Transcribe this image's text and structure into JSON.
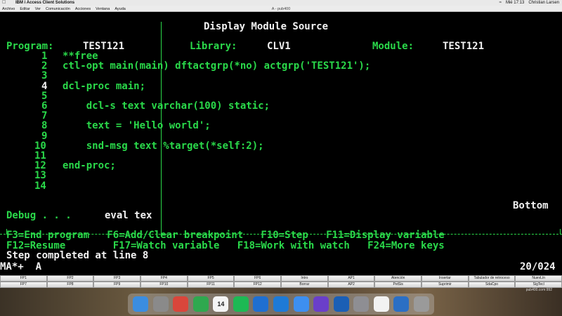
{
  "menubar": {
    "app_name": "IBM i Access Client Solutions",
    "clock": "Mié 17:13",
    "user": "Christian Larsen"
  },
  "appmenu": {
    "items": [
      "Archivo",
      "Editar",
      "Ver",
      "Comunicación",
      "Acciones",
      "Ventana",
      "Ayuda"
    ],
    "window_title": "A - pub400"
  },
  "screen": {
    "header": "Display Module Source",
    "program_label": "Program:",
    "program_value": "TEST121",
    "library_label": "Library:",
    "library_value": "CLV1",
    "module_label": "Module:",
    "module_value": "TEST121",
    "source_lines": [
      {
        "num": "1",
        "text": "**free"
      },
      {
        "num": "2",
        "text": "ctl-opt main(main) dftactgrp(*no) actgrp('TEST121');"
      },
      {
        "num": "3",
        "text": ""
      },
      {
        "num": "4",
        "text": "dcl-proc main;"
      },
      {
        "num": "5",
        "text": ""
      },
      {
        "num": "6",
        "text": "    dcl-s text varchar(100) static;"
      },
      {
        "num": "7",
        "text": ""
      },
      {
        "num": "8",
        "text": "    text = 'Hello world';"
      },
      {
        "num": "9",
        "text": ""
      },
      {
        "num": "10",
        "text": "    snd-msg text %target(*self:2);"
      },
      {
        "num": "11",
        "text": ""
      },
      {
        "num": "12",
        "text": "end-proc;"
      },
      {
        "num": "13",
        "text": ""
      },
      {
        "num": "14",
        "text": ""
      }
    ],
    "bottom_label": "Bottom",
    "debug_label": "Debug . . .",
    "debug_input": "eval tex",
    "fkey_line1": "F3=End program   F6=Add/Clear breakpoint   F10=Step   F11=Display variable",
    "fkey_line2": "F12=Resume        F17=Watch variable   F18=Work with watch   F24=More keys",
    "status_message": "Step completed at line 8",
    "oia_left": "MA*+  A",
    "oia_right": "20/024"
  },
  "fkeybar": {
    "row1": [
      "FP1",
      "FP2",
      "FP3",
      "FP4",
      "FP5",
      "FP6",
      "Intro",
      "AP1",
      "Atención",
      "Insertar",
      "Tabulador de retroceso",
      "NuevLín"
    ],
    "row2": [
      "FP7",
      "FP8",
      "FP9",
      "FP10",
      "FP11",
      "FP12",
      "Borrar",
      "AP2",
      "PetSis",
      "Suprimir",
      "SdaCpo",
      "SigTecl"
    ]
  },
  "status_host": "pub400.com:992",
  "dock": {
    "icons": [
      "finder-icon",
      "launchpad-icon",
      "chrome-icon",
      "numbers-icon",
      "calendar-icon",
      "spotify-icon",
      "xcode-icon",
      "vscode-icon",
      "safari-icon",
      "imovie-icon",
      "ibm-icon",
      "settings-icon",
      "notes-icon",
      "acs-icon",
      "trash-icon"
    ],
    "calendar_day": "14"
  },
  "colors": {
    "terminal_green": "#2ad94a",
    "terminal_white": "#f2f2f2",
    "terminal_bg": "#000000"
  }
}
